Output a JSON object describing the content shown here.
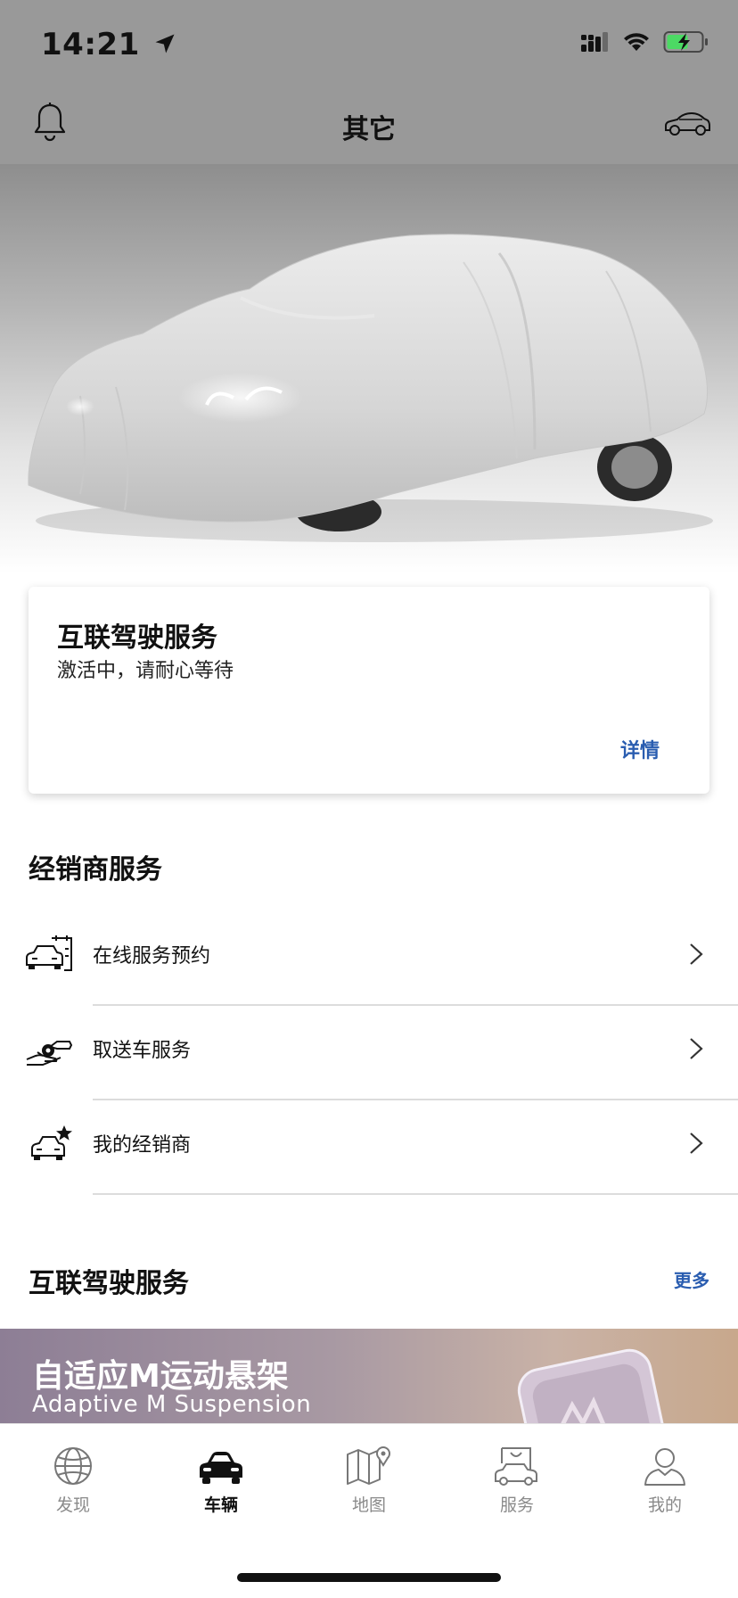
{
  "status_bar": {
    "time": "14:21"
  },
  "header": {
    "title": "其它"
  },
  "connected_drive_card": {
    "title": "互联驾驶服务",
    "subtitle": "激活中，请耐心等待",
    "link": "详情"
  },
  "dealer_services": {
    "title": "经销商服务",
    "items": [
      {
        "label": "在线服务预约",
        "icon": "car-calendar-icon"
      },
      {
        "label": "取送车服务",
        "icon": "key-handover-icon"
      },
      {
        "label": "我的经销商",
        "icon": "car-star-icon"
      }
    ]
  },
  "connected_drive_services": {
    "title": "互联驾驶服务",
    "more": "更多",
    "banner": {
      "title": "自适应M运动悬架",
      "subtitle": "Adaptive M Suspension"
    }
  },
  "tab_bar": {
    "tabs": [
      {
        "label": "发现",
        "icon": "globe-icon",
        "active": false
      },
      {
        "label": "车辆",
        "icon": "car-icon",
        "active": true
      },
      {
        "label": "地图",
        "icon": "map-icon",
        "active": false
      },
      {
        "label": "服务",
        "icon": "shopping-bag-car-icon",
        "active": false
      },
      {
        "label": "我的",
        "icon": "user-icon",
        "active": false
      }
    ]
  },
  "colors": {
    "header_bg": "#999999",
    "link_blue": "#2a5db0",
    "battery_green": "#4cd964"
  }
}
